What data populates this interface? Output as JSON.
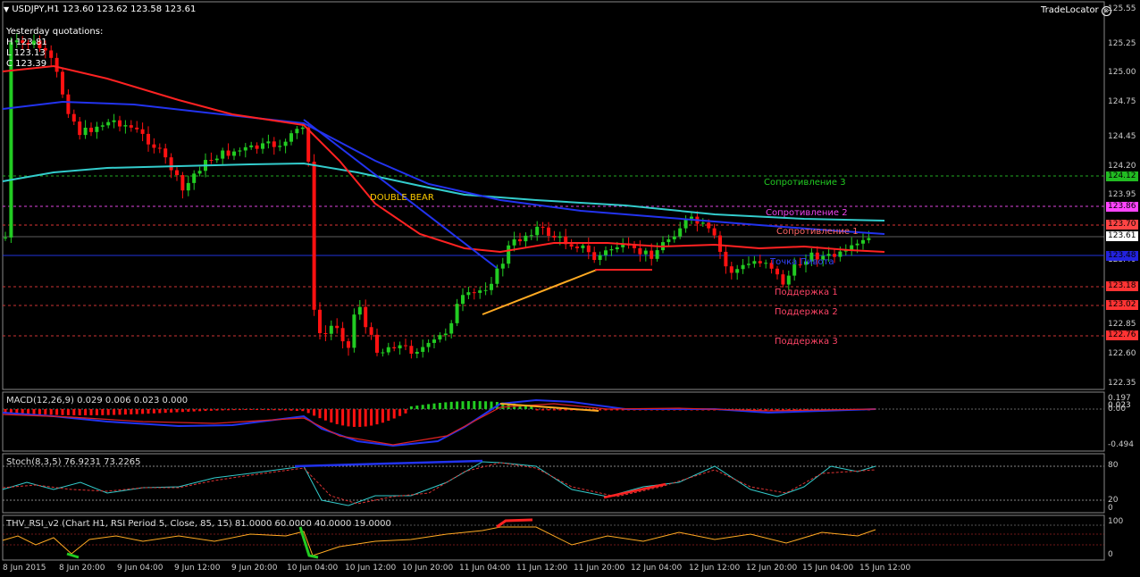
{
  "header": {
    "symbol_line": "USDJPY,H1  123.60 123.62 123.58 123.61",
    "tradelocator_label": "TradeLocator"
  },
  "yesterday": {
    "title": "Yesterday quotations:",
    "h": "H 123.81",
    "l": "L 123.13",
    "c": "C 123.39"
  },
  "annotations": {
    "double_bear": "DOUBLE  BEAR",
    "resist3": "Сопротивление 3",
    "resist2": "Сопротивление 2",
    "resist1": "Сопротивление 1",
    "pivot": "Точка Пивота",
    "support1": "Поддержка 1",
    "support2": "Поддержка 2",
    "support3": "Поддержка 3"
  },
  "price_axis": [
    "125.55",
    "125.25",
    "125.00",
    "124.75",
    "124.45",
    "124.20",
    "123.95",
    "123.40",
    "122.85",
    "122.60",
    "122.35"
  ],
  "price_tags": [
    {
      "value": "124.12",
      "color": "#22bb22"
    },
    {
      "value": "123.86",
      "color": "#ff44ff"
    },
    {
      "value": "123.70",
      "color": "#ff4444"
    },
    {
      "value": "123.61",
      "color": "#ffffff"
    },
    {
      "value": "123.48",
      "color": "#2222dd"
    },
    {
      "value": "123.18",
      "color": "#ff3333"
    },
    {
      "value": "123.02",
      "color": "#ff3333"
    },
    {
      "value": "122.76",
      "color": "#ff3333"
    }
  ],
  "macd": {
    "label": "MACD(12,26,9) 0.029 0.006 0.023 0.000",
    "axis": [
      "0.197",
      "0.023",
      "0.00",
      "-0.494"
    ]
  },
  "stoch": {
    "label": "Stoch(8,3,5) 76.9231 73.2265",
    "axis": [
      "80",
      "20",
      "0"
    ]
  },
  "rsi": {
    "label": "THV_RSI_v2  (Chart H1,  RSI Period 5,  Close,  85,  15)  81.0000 60.0000 40.0000 19.0000",
    "axis": [
      "100",
      "0"
    ]
  },
  "time_axis": [
    "8 Jun 2015",
    "8 Jun 20:00",
    "9 Jun 04:00",
    "9 Jun 12:00",
    "9 Jun 20:00",
    "10 Jun 04:00",
    "10 Jun 12:00",
    "10 Jun 20:00",
    "11 Jun 04:00",
    "11 Jun 12:00",
    "11 Jun 20:00",
    "12 Jun 04:00",
    "12 Jun 12:00",
    "12 Jun 20:00",
    "15 Jun 04:00",
    "15 Jun 12:00"
  ],
  "colors": {
    "bull": "#22cc22",
    "bear": "#ff1111",
    "ma_red": "#ff2222",
    "ma_blue": "#2233ee",
    "ma_cyan": "#33cccc",
    "trend_orange": "#ffaa22"
  }
}
